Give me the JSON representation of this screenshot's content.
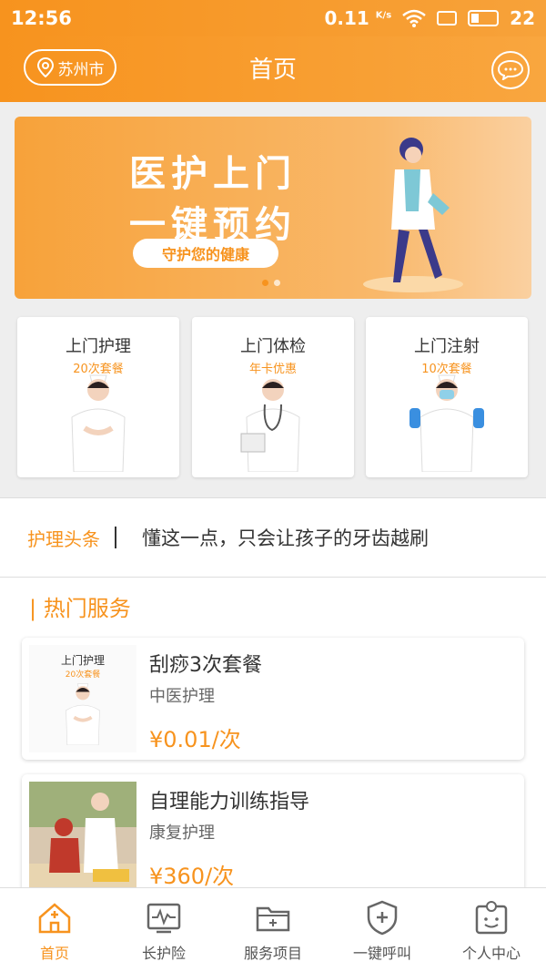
{
  "status_bar": {
    "time": "12:56",
    "speed": "0.11",
    "speed_unit": "K/s",
    "battery": "22"
  },
  "header": {
    "city": "苏州市",
    "title": "首页"
  },
  "banner": {
    "line1": "医护上门",
    "line2": "一键预约",
    "pill": "守护您的健康"
  },
  "cards": [
    {
      "title": "上门护理",
      "sub": "20次套餐"
    },
    {
      "title": "上门体检",
      "sub": "年卡优惠"
    },
    {
      "title": "上门注射",
      "sub": "10次套餐"
    }
  ],
  "news": {
    "label": "护理头条",
    "text": "懂这一点，只会让孩子的牙齿越刷"
  },
  "hot": {
    "title": "| 热门服务",
    "items": [
      {
        "thumb_title": "上门护理",
        "thumb_sub": "20次套餐",
        "name": "刮痧3次套餐",
        "category": "中医护理",
        "price": "¥0.01/次"
      },
      {
        "name": "自理能力训练指导",
        "category": "康复护理",
        "price": "¥360/次"
      }
    ]
  },
  "nav": [
    {
      "label": "首页",
      "icon": "home-icon"
    },
    {
      "label": "长护险",
      "icon": "monitor-icon"
    },
    {
      "label": "服务项目",
      "icon": "folder-icon"
    },
    {
      "label": "一键呼叫",
      "icon": "shield-plus-icon"
    },
    {
      "label": "个人中心",
      "icon": "profile-icon"
    }
  ],
  "colors": {
    "accent": "#f7931e"
  }
}
